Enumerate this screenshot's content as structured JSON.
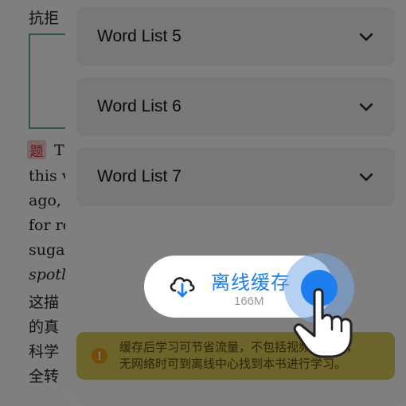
{
  "background_document": {
    "lines": [
      "抗拒",
      "T",
      "this v",
      "ago,",
      "for re",
      "sugar",
      "spotli",
      "这描",
      "的真",
      "科学",
      "全转"
    ],
    "tag": "题"
  },
  "word_lists": [
    {
      "label": "Word List 5"
    },
    {
      "label": "Word List 6"
    },
    {
      "label": "Word List 7"
    }
  ],
  "offline_cache": {
    "title": "离线缓存",
    "size": "166M",
    "icon": "cloud-download-icon",
    "accent_color": "#1d7ef0"
  },
  "notice": {
    "icon": "exclamation-icon",
    "line1": "缓存后学习可节省流量，不包括视频和做题，",
    "line2": "无网络时可到离线中心找到本书进行学习。"
  }
}
